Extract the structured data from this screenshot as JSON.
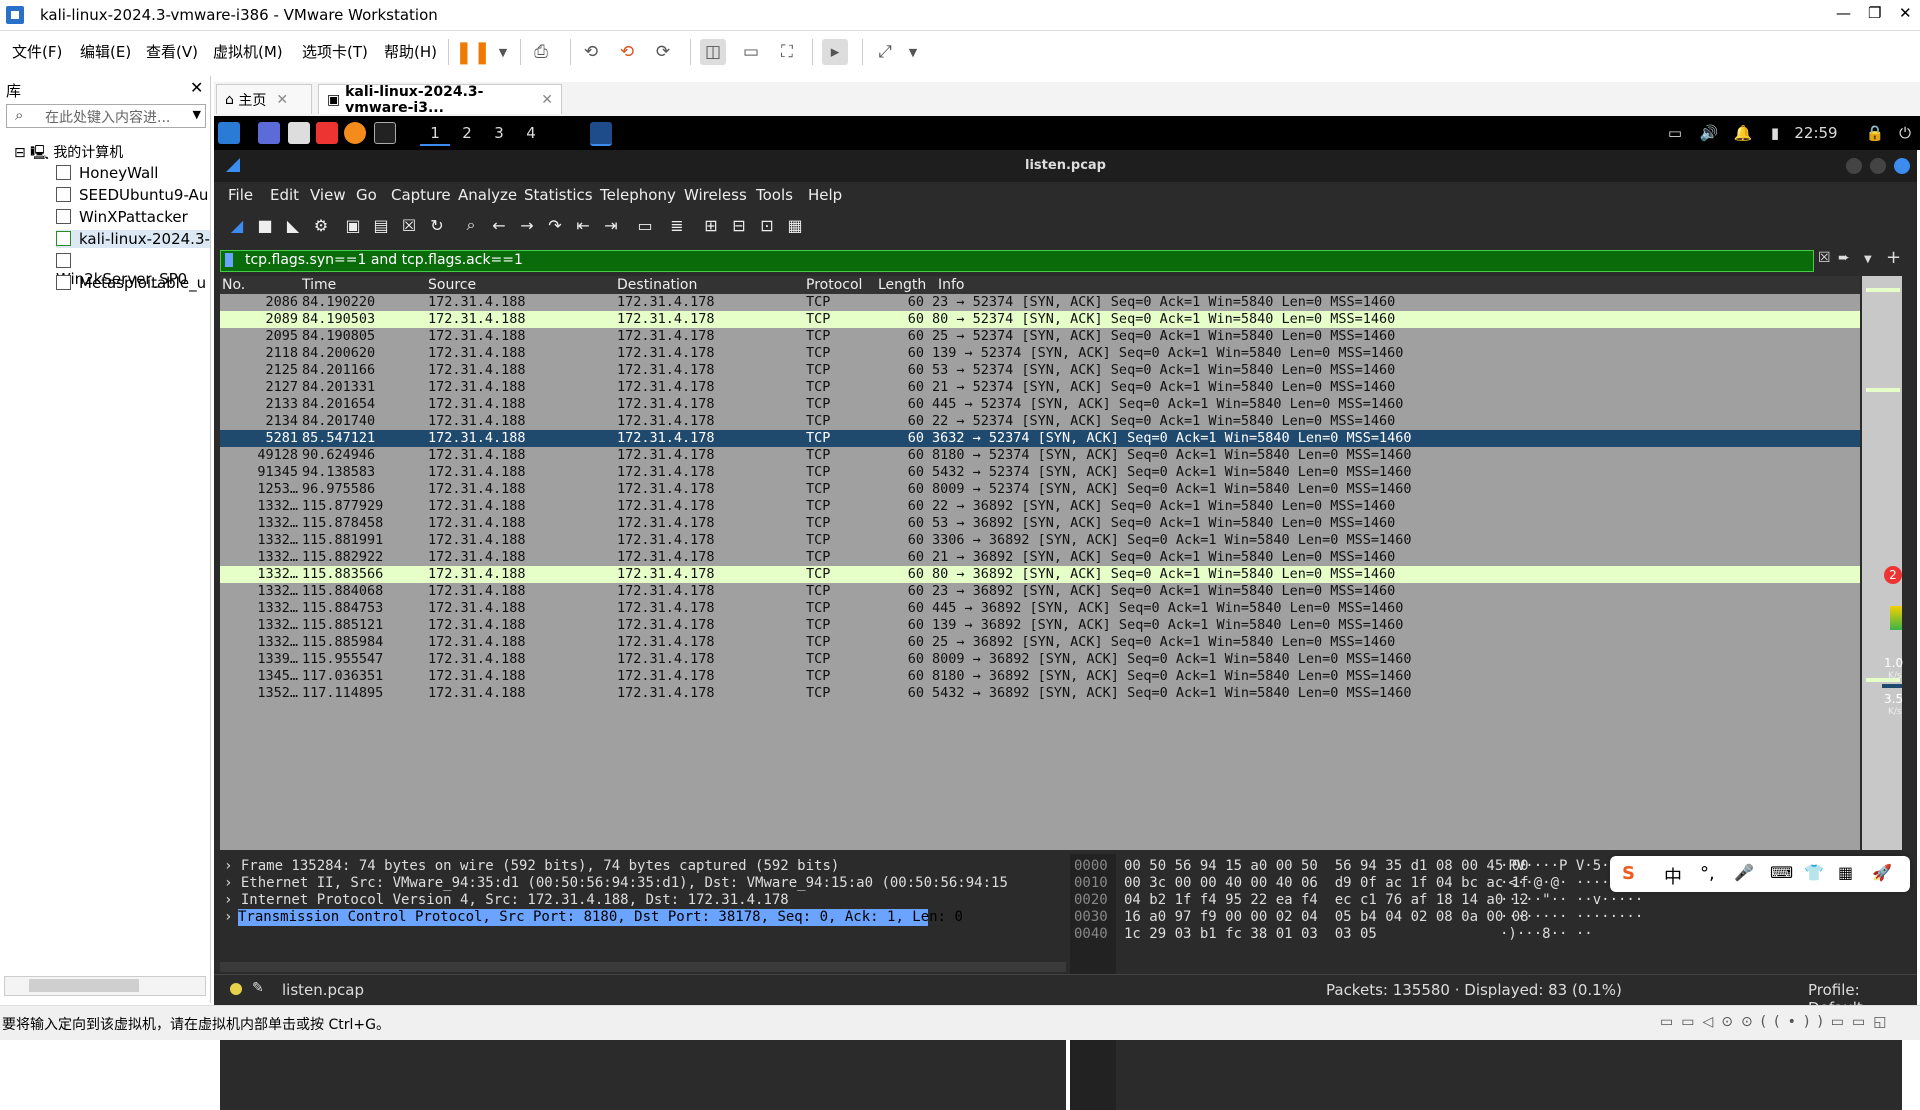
{
  "vmware": {
    "title": "kali-linux-2024.3-vmware-i386 - VMware Workstation",
    "window_controls": [
      "—",
      "❐",
      "✕"
    ],
    "menu": [
      "文件(F)",
      "编辑(E)",
      "查看(V)",
      "虚拟机(M)",
      "选项卡(T)",
      "帮助(H)"
    ],
    "library": {
      "title": "库",
      "search_placeholder": "在此处键入内容进...",
      "root": "我的计算机",
      "items": [
        "HoneyWall",
        "SEEDUbuntu9-Au",
        "WinXPattacker",
        "kali-linux-2024.3-",
        "Win2kServer_SP0",
        "Metasploitable_u"
      ]
    },
    "tabs": [
      {
        "label": "主页"
      },
      {
        "label": "kali-linux-2024.3-vmware-i3..."
      }
    ],
    "status_text": "要将输入定向到该虚拟机，请在虚拟机内部单击或按 Ctrl+G。"
  },
  "kali_panel": {
    "workspaces": [
      "1",
      "2",
      "3",
      "4"
    ],
    "clock": "22:59"
  },
  "wireshark": {
    "window_title": "listen.pcap",
    "menu": [
      "File",
      "Edit",
      "View",
      "Go",
      "Capture",
      "Analyze",
      "Statistics",
      "Telephony",
      "Wireless",
      "Tools",
      "Help"
    ],
    "filter": "tcp.flags.syn==1 and tcp.flags.ack==1",
    "columns": [
      "No.",
      "Time",
      "Source",
      "Destination",
      "Protocol",
      "Length",
      "Info"
    ],
    "packets": [
      {
        "no": "2086",
        "time": "84.190220",
        "src": "172.31.4.188",
        "dst": "172.31.4.178",
        "proto": "TCP",
        "len": "60",
        "info": "23 → 52374 [SYN, ACK] Seq=0 Ack=1 Win=5840 Len=0 MSS=1460",
        "style": "normal"
      },
      {
        "no": "2089",
        "time": "84.190503",
        "src": "172.31.4.188",
        "dst": "172.31.4.178",
        "proto": "TCP",
        "len": "60",
        "info": "80 → 52374 [SYN, ACK] Seq=0 Ack=1 Win=5840 Len=0 MSS=1460",
        "style": "hl"
      },
      {
        "no": "2095",
        "time": "84.190805",
        "src": "172.31.4.188",
        "dst": "172.31.4.178",
        "proto": "TCP",
        "len": "60",
        "info": "25 → 52374 [SYN, ACK] Seq=0 Ack=1 Win=5840 Len=0 MSS=1460",
        "style": "normal"
      },
      {
        "no": "2118",
        "time": "84.200620",
        "src": "172.31.4.188",
        "dst": "172.31.4.178",
        "proto": "TCP",
        "len": "60",
        "info": "139 → 52374 [SYN, ACK] Seq=0 Ack=1 Win=5840 Len=0 MSS=1460",
        "style": "normal"
      },
      {
        "no": "2125",
        "time": "84.201166",
        "src": "172.31.4.188",
        "dst": "172.31.4.178",
        "proto": "TCP",
        "len": "60",
        "info": "53 → 52374 [SYN, ACK] Seq=0 Ack=1 Win=5840 Len=0 MSS=1460",
        "style": "normal"
      },
      {
        "no": "2127",
        "time": "84.201331",
        "src": "172.31.4.188",
        "dst": "172.31.4.178",
        "proto": "TCP",
        "len": "60",
        "info": "21 → 52374 [SYN, ACK] Seq=0 Ack=1 Win=5840 Len=0 MSS=1460",
        "style": "normal"
      },
      {
        "no": "2133",
        "time": "84.201654",
        "src": "172.31.4.188",
        "dst": "172.31.4.178",
        "proto": "TCP",
        "len": "60",
        "info": "445 → 52374 [SYN, ACK] Seq=0 Ack=1 Win=5840 Len=0 MSS=1460",
        "style": "normal"
      },
      {
        "no": "2134",
        "time": "84.201740",
        "src": "172.31.4.188",
        "dst": "172.31.4.178",
        "proto": "TCP",
        "len": "60",
        "info": "22 → 52374 [SYN, ACK] Seq=0 Ack=1 Win=5840 Len=0 MSS=1460",
        "style": "normal"
      },
      {
        "no": "5281",
        "time": "85.547121",
        "src": "172.31.4.188",
        "dst": "172.31.4.178",
        "proto": "TCP",
        "len": "60",
        "info": "3632 → 52374 [SYN, ACK] Seq=0 Ack=1 Win=5840 Len=0 MSS=1460",
        "style": "sel"
      },
      {
        "no": "49128",
        "time": "90.624946",
        "src": "172.31.4.188",
        "dst": "172.31.4.178",
        "proto": "TCP",
        "len": "60",
        "info": "8180 → 52374 [SYN, ACK] Seq=0 Ack=1 Win=5840 Len=0 MSS=1460",
        "style": "normal"
      },
      {
        "no": "91345",
        "time": "94.138583",
        "src": "172.31.4.188",
        "dst": "172.31.4.178",
        "proto": "TCP",
        "len": "60",
        "info": "5432 → 52374 [SYN, ACK] Seq=0 Ack=1 Win=5840 Len=0 MSS=1460",
        "style": "normal"
      },
      {
        "no": "1253…",
        "time": "96.975586",
        "src": "172.31.4.188",
        "dst": "172.31.4.178",
        "proto": "TCP",
        "len": "60",
        "info": "8009 → 52374 [SYN, ACK] Seq=0 Ack=1 Win=5840 Len=0 MSS=1460",
        "style": "normal"
      },
      {
        "no": "1332…",
        "time": "115.877929",
        "src": "172.31.4.188",
        "dst": "172.31.4.178",
        "proto": "TCP",
        "len": "60",
        "info": "22 → 36892 [SYN, ACK] Seq=0 Ack=1 Win=5840 Len=0 MSS=1460",
        "style": "normal"
      },
      {
        "no": "1332…",
        "time": "115.878458",
        "src": "172.31.4.188",
        "dst": "172.31.4.178",
        "proto": "TCP",
        "len": "60",
        "info": "53 → 36892 [SYN, ACK] Seq=0 Ack=1 Win=5840 Len=0 MSS=1460",
        "style": "normal"
      },
      {
        "no": "1332…",
        "time": "115.881991",
        "src": "172.31.4.188",
        "dst": "172.31.4.178",
        "proto": "TCP",
        "len": "60",
        "info": "3306 → 36892 [SYN, ACK] Seq=0 Ack=1 Win=5840 Len=0 MSS=1460",
        "style": "normal"
      },
      {
        "no": "1332…",
        "time": "115.882922",
        "src": "172.31.4.188",
        "dst": "172.31.4.178",
        "proto": "TCP",
        "len": "60",
        "info": "21 → 36892 [SYN, ACK] Seq=0 Ack=1 Win=5840 Len=0 MSS=1460",
        "style": "normal"
      },
      {
        "no": "1332…",
        "time": "115.883566",
        "src": "172.31.4.188",
        "dst": "172.31.4.178",
        "proto": "TCP",
        "len": "60",
        "info": "80 → 36892 [SYN, ACK] Seq=0 Ack=1 Win=5840 Len=0 MSS=1460",
        "style": "hl"
      },
      {
        "no": "1332…",
        "time": "115.884068",
        "src": "172.31.4.188",
        "dst": "172.31.4.178",
        "proto": "TCP",
        "len": "60",
        "info": "23 → 36892 [SYN, ACK] Seq=0 Ack=1 Win=5840 Len=0 MSS=1460",
        "style": "normal"
      },
      {
        "no": "1332…",
        "time": "115.884753",
        "src": "172.31.4.188",
        "dst": "172.31.4.178",
        "proto": "TCP",
        "len": "60",
        "info": "445 → 36892 [SYN, ACK] Seq=0 Ack=1 Win=5840 Len=0 MSS=1460",
        "style": "normal"
      },
      {
        "no": "1332…",
        "time": "115.885121",
        "src": "172.31.4.188",
        "dst": "172.31.4.178",
        "proto": "TCP",
        "len": "60",
        "info": "139 → 36892 [SYN, ACK] Seq=0 Ack=1 Win=5840 Len=0 MSS=1460",
        "style": "normal"
      },
      {
        "no": "1332…",
        "time": "115.885984",
        "src": "172.31.4.188",
        "dst": "172.31.4.178",
        "proto": "TCP",
        "len": "60",
        "info": "25 → 36892 [SYN, ACK] Seq=0 Ack=1 Win=5840 Len=0 MSS=1460",
        "style": "normal"
      },
      {
        "no": "1339…",
        "time": "115.955547",
        "src": "172.31.4.188",
        "dst": "172.31.4.178",
        "proto": "TCP",
        "len": "60",
        "info": "8009 → 36892 [SYN, ACK] Seq=0 Ack=1 Win=5840 Len=0 MSS=1460",
        "style": "normal"
      },
      {
        "no": "1345…",
        "time": "117.036351",
        "src": "172.31.4.188",
        "dst": "172.31.4.178",
        "proto": "TCP",
        "len": "60",
        "info": "8180 → 36892 [SYN, ACK] Seq=0 Ack=1 Win=5840 Len=0 MSS=1460",
        "style": "normal"
      },
      {
        "no": "1352…",
        "time": "117.114895",
        "src": "172.31.4.188",
        "dst": "172.31.4.178",
        "proto": "TCP",
        "len": "60",
        "info": "5432 → 36892 [SYN, ACK] Seq=0 Ack=1 Win=5840 Len=0 MSS=1460",
        "style": "normal"
      }
    ],
    "details": [
      "Frame 135284: 74 bytes on wire (592 bits), 74 bytes captured (592 bits)",
      "Ethernet II, Src: VMware_94:35:d1 (00:50:56:94:35:d1), Dst: VMware_94:15:a0 (00:50:56:94:15",
      "Internet Protocol Version 4, Src: 172.31.4.188, Dst: 172.31.4.178",
      "Transmission Control Protocol, Src Port: 8180, Dst Port: 38178, Seq: 0, Ack: 1, Len: 0"
    ],
    "bytes": [
      {
        "off": "0000",
        "hex": "00 50 56 94 15 a0 00 50  56 94 35 d1 08 00 45 00",
        "ascii": "·PV····P V·5···E·"
      },
      {
        "off": "0010",
        "hex": "00 3c 00 00 40 00 40 06  d9 0f ac 1f 04 bc ac 1f",
        "ascii": "·<··@·@· ········"
      },
      {
        "off": "0020",
        "hex": "04 b2 1f f4 95 22 ea f4  ec c1 76 af 18 14 a0 12",
        "ascii": "·····\"·· ··v·····"
      },
      {
        "off": "0030",
        "hex": "16 a0 97 f9 00 00 02 04  05 b4 04 02 08 0a 00 08",
        "ascii": "········ ········"
      },
      {
        "off": "0040",
        "hex": "1c 29 03 b1 fc 38 01 03  03 05",
        "ascii": "·)···8·· ··"
      }
    ],
    "status": {
      "file": "listen.pcap",
      "packets": "Packets: 135580 · Displayed: 83 (0.1%)",
      "profile": "Profile: Default"
    },
    "side_badge": "2",
    "net_rate_1": "1.0",
    "net_unit_1": "K/s",
    "net_rate_2": "3.5",
    "net_unit_2": "K/s"
  },
  "ime": [
    "中",
    "°,",
    "🎤",
    "⌨",
    "👕",
    "▦",
    "🚀"
  ]
}
